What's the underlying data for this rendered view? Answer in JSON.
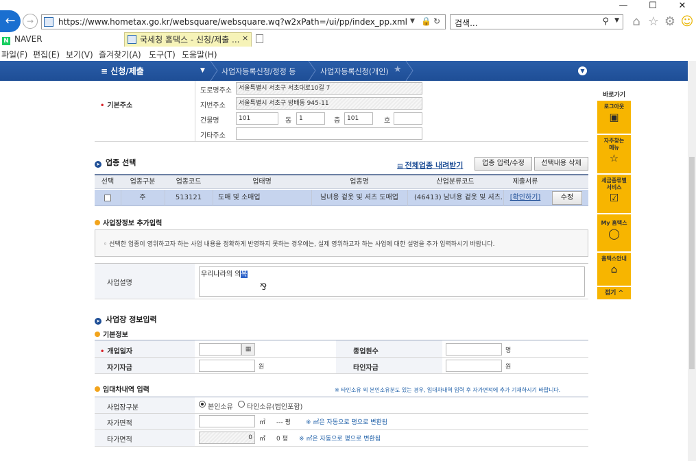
{
  "browser": {
    "window_controls": [
      "—",
      "☐",
      "✕"
    ],
    "url": "https://www.hometax.go.kr/websquare/websquare.wq?w2xPath=/ui/pp/index_pp.xml",
    "search_placeholder": "검색...",
    "tabs": [
      {
        "label": "NAVER",
        "active": false
      },
      {
        "label": "국세청 홈택스 - 신청/제출 ...",
        "active": true
      }
    ],
    "tab_close": "×",
    "menu": [
      "파일(F)",
      "편집(E)",
      "보기(V)",
      "즐겨찾기(A)",
      "도구(T)",
      "도움말(H)"
    ]
  },
  "nav": {
    "menu_label": "≡ 신청/제출",
    "breadcrumbs": [
      "사업자등록신청/정정 등",
      "사업자등록신청(개인)"
    ],
    "brand_color": "#1e4e96"
  },
  "address": {
    "label": "기본주소",
    "road_label": "도로명주소",
    "road_value": "서울특별시 서초구 서초대로10길 7",
    "lot_label": "지번주소",
    "lot_value": "서울특별시 서초구 방배동 945-11",
    "building_label": "건물명",
    "building_value": "101",
    "dong_label": "동",
    "dong_value": "1",
    "floor_label": "층",
    "floor_value": "101",
    "ho_label": "호",
    "ho_value": "",
    "other_label": "기타주소",
    "other_value": ""
  },
  "industry": {
    "title": "업종 선택",
    "download_link": "전체업종 내려받기",
    "btn_edit": "업종 입력/수정",
    "btn_delete": "선택내용 삭제",
    "columns": [
      "선택",
      "업종구분",
      "업종코드",
      "업태명",
      "업종명",
      "산업분류코드",
      "제출서류"
    ],
    "rows": [
      {
        "type": "주",
        "code": "513121",
        "business": "도매 및 소매업",
        "item": "남녀용 겉옷 및 셔츠 도매업",
        "class_code": "(46413) 남녀용 겉옷 및 셔츠…",
        "doc_link": "[확인하기]",
        "edit_btn": "수정"
      }
    ]
  },
  "extra": {
    "title": "사업장정보 추가입력",
    "notice": "선택한 업종이 영위하고자 하는 사업 내용을 정확하게 반영하지 못하는 경우에는, 실제 영위하고자 하는 사업에 대한 설명을 추가 입력하시기 바랍니다.",
    "desc_label": "사업설명",
    "desc_value": "우리나라의 의",
    "desc_composing": "복"
  },
  "workplace": {
    "title": "사업장 정보입력",
    "basic_title": "기본정보",
    "open_date_label": "개업일자",
    "open_date_value": "",
    "employees_label": "종업원수",
    "employees_unit": "명",
    "own_capital_label": "자기자금",
    "own_capital_unit": "원",
    "other_capital_label": "타인자금",
    "other_capital_unit": "원"
  },
  "lease": {
    "title": "임대차내역 입력",
    "note": "※ 타인소유 외 본인소유분도 있는 경우, 임대차내역 입력 후 자가면적에 추가 기재하시기 바랍니다.",
    "type_label": "사업장구분",
    "opt_own": "본인소유",
    "opt_other": "타인소유(법인포함)",
    "own_area_label": "자가면적",
    "own_area_value": "",
    "own_area_pyeong": "--- 평",
    "other_area_label": "타가면적",
    "other_area_value": "0",
    "other_area_pyeong": "0 평",
    "unit_m2": "㎡",
    "convert_note": "※ ㎡은 자동으로 평으로 변환됨"
  },
  "quick_menu": {
    "title": "바로가기",
    "items": [
      {
        "label": "로그아웃",
        "icon": "lock-icon"
      },
      {
        "label": "자주찾는 메뉴",
        "icon": "star-icon"
      },
      {
        "label": "세금종류별 서비스",
        "icon": "checkbox-icon"
      },
      {
        "label": "My 홈택스",
        "icon": "person-icon"
      },
      {
        "label": "홈택스안내",
        "icon": "house-icon"
      }
    ],
    "fold": "접기 ^",
    "accent": "#f7b500"
  }
}
